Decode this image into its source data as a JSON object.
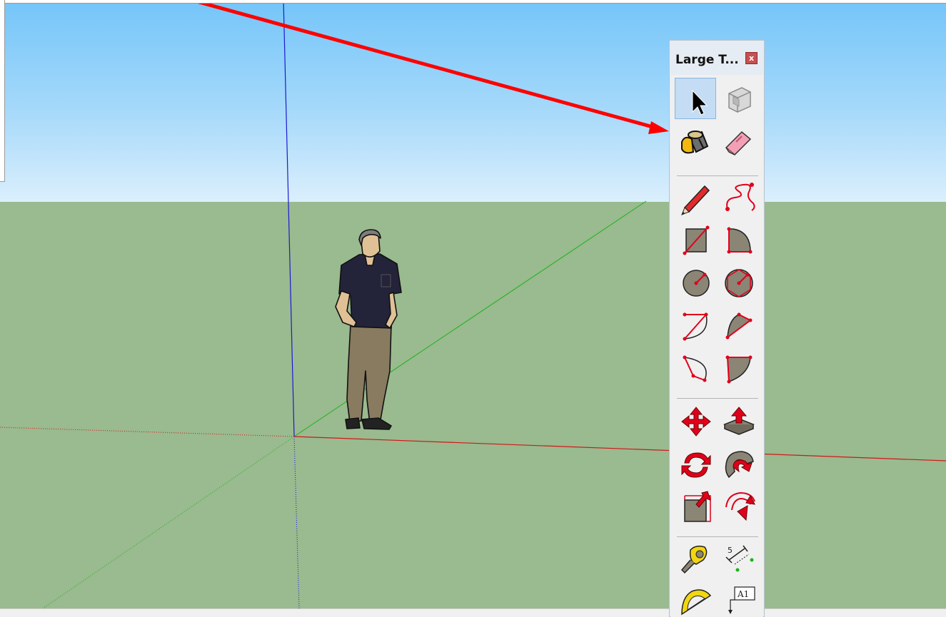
{
  "toolbar": {
    "title": "Large T...",
    "close_label": "x",
    "selected_tool": "select",
    "tools": [
      {
        "id": "select",
        "icon": "arrow-cursor-icon"
      },
      {
        "id": "make-component",
        "icon": "component-box-icon"
      },
      {
        "id": "paint-bucket",
        "icon": "paint-bucket-icon"
      },
      {
        "id": "eraser",
        "icon": "eraser-icon"
      },
      {
        "id": "line",
        "icon": "pencil-icon"
      },
      {
        "id": "freehand",
        "icon": "freehand-icon"
      },
      {
        "id": "rectangle",
        "icon": "rectangle-icon"
      },
      {
        "id": "rotated-rectangle",
        "icon": "rotated-rectangle-icon"
      },
      {
        "id": "circle",
        "icon": "circle-icon"
      },
      {
        "id": "polygon",
        "icon": "polygon-icon"
      },
      {
        "id": "arc",
        "icon": "arc-icon"
      },
      {
        "id": "two-point-arc",
        "icon": "two-point-arc-icon"
      },
      {
        "id": "three-point-arc",
        "icon": "three-point-arc-icon"
      },
      {
        "id": "pie",
        "icon": "pie-icon"
      },
      {
        "id": "move",
        "icon": "move-icon"
      },
      {
        "id": "push-pull",
        "icon": "push-pull-icon"
      },
      {
        "id": "rotate",
        "icon": "rotate-icon"
      },
      {
        "id": "follow-me",
        "icon": "follow-me-icon"
      },
      {
        "id": "scale",
        "icon": "scale-icon"
      },
      {
        "id": "offset",
        "icon": "offset-icon"
      },
      {
        "id": "tape-measure",
        "icon": "tape-measure-icon"
      },
      {
        "id": "dimension",
        "icon": "dimension-icon"
      },
      {
        "id": "protractor",
        "icon": "protractor-icon"
      },
      {
        "id": "text",
        "icon": "text-icon",
        "label": "A1"
      }
    ]
  },
  "colors": {
    "sky_top": "#74c5f9",
    "sky_bottom": "#dbeffd",
    "ground": "#9aba8f",
    "axis_red": "#d01818",
    "axis_green": "#18b418",
    "axis_blue": "#1a1ad4",
    "annotation_arrow": "#ff0000",
    "icon_red": "#e0001b",
    "icon_gray": "#8a8575"
  }
}
